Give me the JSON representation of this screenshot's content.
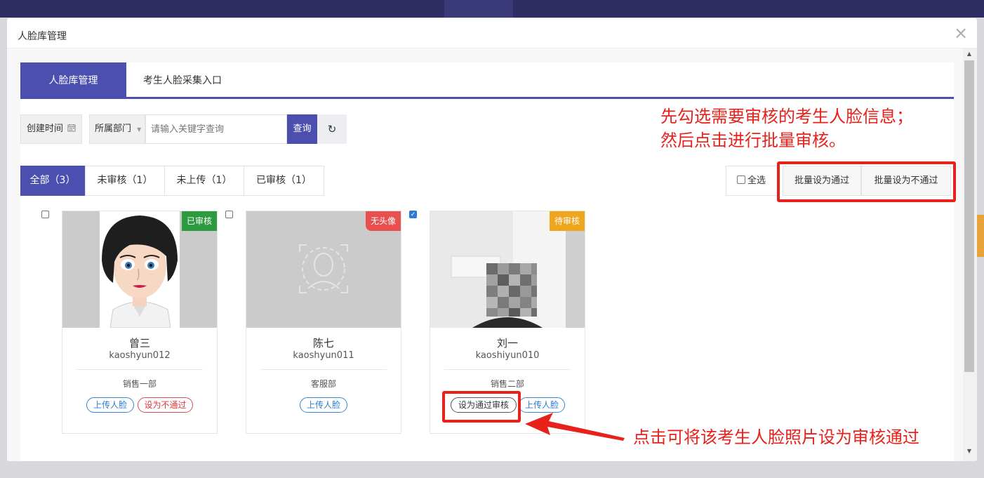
{
  "modal": {
    "title": "人脸库管理",
    "close": "×"
  },
  "tabs": {
    "main": "人脸库管理",
    "secondary": "考生人脸采集入口"
  },
  "filters": {
    "date_label": "创建时间",
    "date_icon": "calendar-icon",
    "dept_label": "所属部门",
    "search_placeholder": "请输入关键字查询",
    "query_label": "查询",
    "reset_icon": "refresh-icon",
    "reset_symbol": "↻"
  },
  "status_tabs": [
    {
      "label": "全部（3）",
      "active": true
    },
    {
      "label": "未审核（1）",
      "active": false
    },
    {
      "label": "未上传（1）",
      "active": false
    },
    {
      "label": "已审核（1）",
      "active": false
    }
  ],
  "batch": {
    "select_all": "全选",
    "pass": "批量设为通过",
    "fail": "批量设为不通过"
  },
  "annotations": {
    "top_line1": "先勾选需要审核的考生人脸信息；",
    "top_line2": "然后点击进行批量审核。",
    "bottom": "点击可将该考生人脸照片设为审核通过"
  },
  "cards": [
    {
      "name": "曾三",
      "id": "kaoshyun012",
      "dept": "销售一部",
      "badge": "已审核",
      "checked": false,
      "photo": "avatar",
      "actions": [
        "上传人脸",
        "设为不通过"
      ]
    },
    {
      "name": "陈七",
      "id": "kaoshyun011",
      "dept": "客服部",
      "badge": "无头像",
      "checked": false,
      "photo": "placeholder",
      "actions": [
        "上传人脸"
      ]
    },
    {
      "name": "刘一",
      "id": "kaoshiyun010",
      "dept": "销售二部",
      "badge": "待审核",
      "checked": true,
      "photo": "pixelated",
      "actions": [
        "设为通过审核",
        "上传人脸"
      ]
    }
  ],
  "colors": {
    "primary": "#4a4fb0",
    "annotation": "#e8211a",
    "badge_pass": "#2c9a3f",
    "badge_none": "#e94f4f",
    "badge_wait": "#f0a61c"
  }
}
